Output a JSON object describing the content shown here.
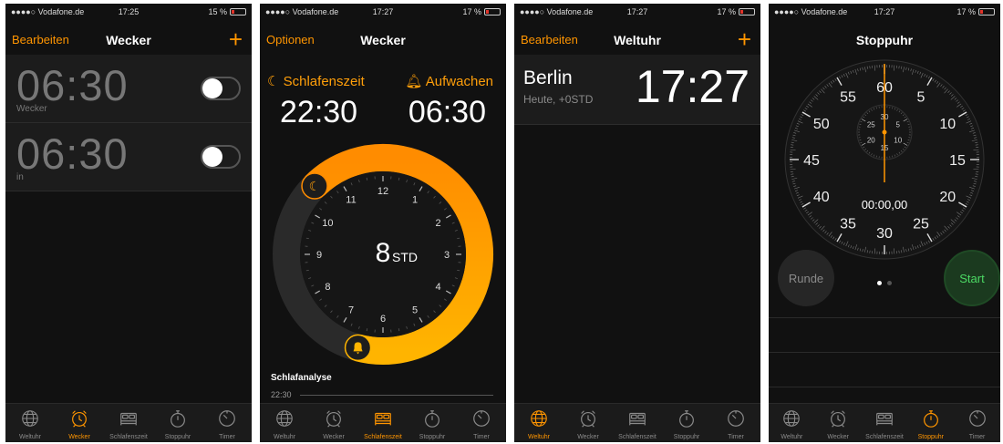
{
  "colors": {
    "accent": "#ff9500",
    "background": "#111111",
    "row": "#1c1c1c",
    "start_green": "#4cd964",
    "battery_low": "#e0342b"
  },
  "screens": [
    {
      "status": {
        "carrier": "●●●●○ Vodafone.de",
        "time": "17:25",
        "battery": "15 %"
      },
      "nav": {
        "left": "Bearbeiten",
        "title": "Wecker",
        "right_icon": "plus-icon"
      },
      "alarms": [
        {
          "time": "06:30",
          "label": "Wecker",
          "enabled": false
        },
        {
          "time": "06:30",
          "label": "in",
          "enabled": false
        }
      ],
      "active_tab": 1
    },
    {
      "status": {
        "carrier": "●●●●○ Vodafone.de",
        "time": "17:27",
        "battery": "17 %"
      },
      "nav": {
        "left": "Optionen",
        "title": "Wecker"
      },
      "bedtime": {
        "label": "Schlafenszeit",
        "time": "22:30"
      },
      "wakeup": {
        "label": "Aufwachen",
        "time": "06:30"
      },
      "duration": {
        "value": "8",
        "unit": "STD"
      },
      "dial_numbers": [
        "12",
        "1",
        "2",
        "3",
        "4",
        "5",
        "6",
        "7",
        "8",
        "9",
        "10",
        "11"
      ],
      "analysis": {
        "label": "Schlafanalyse",
        "time": "22:30"
      },
      "active_tab": 2
    },
    {
      "status": {
        "carrier": "●●●●○ Vodafone.de",
        "time": "17:27",
        "battery": "17 %"
      },
      "nav": {
        "left": "Bearbeiten",
        "title": "Weltuhr",
        "right_icon": "plus-icon"
      },
      "clock": {
        "city": "Berlin",
        "offset": "Heute, +0STD",
        "time": "17:27"
      },
      "active_tab": 0
    },
    {
      "status": {
        "carrier": "●●●●○ Vodafone.de",
        "time": "17:27",
        "battery": "17 %"
      },
      "nav": {
        "title": "Stoppuhr"
      },
      "stopwatch": {
        "display": "00:00,00",
        "outer_numbers": [
          "60",
          "5",
          "10",
          "15",
          "20",
          "25",
          "30",
          "35",
          "40",
          "45",
          "50",
          "55"
        ],
        "inner_numbers": [
          "30",
          "5",
          "10",
          "15",
          "20",
          "25"
        ],
        "lap_label": "Runde",
        "start_label": "Start"
      },
      "active_tab": 3
    }
  ],
  "tabs": [
    {
      "label": "Weltuhr",
      "icon": "globe-icon"
    },
    {
      "label": "Wecker",
      "icon": "alarm-clock-icon"
    },
    {
      "label": "Schlafenszeit",
      "icon": "bed-icon"
    },
    {
      "label": "Stoppuhr",
      "icon": "stopwatch-icon"
    },
    {
      "label": "Timer",
      "icon": "timer-icon"
    }
  ]
}
